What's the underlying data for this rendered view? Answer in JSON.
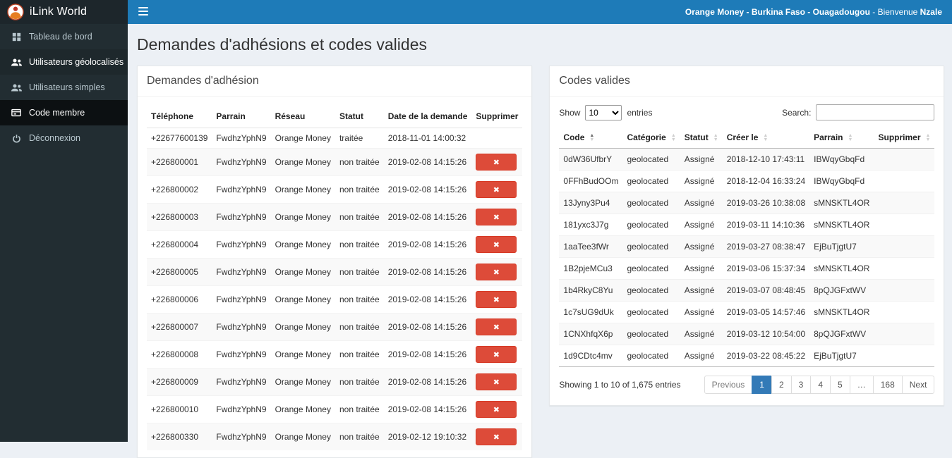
{
  "colors": {
    "topbar": "#1e7bb8",
    "sidebar": "#222d32",
    "sidebar_active": "#1e282c",
    "danger": "#dd4b39",
    "pagination_active": "#337ab7",
    "content_bg": "#ecf0f5"
  },
  "topbar": {
    "brand": "iLink World",
    "logo_icon": "ilink-logo-icon",
    "menu_icon": "hamburger-icon",
    "segments": [
      {
        "text": "Orange Money",
        "bold": true
      },
      {
        "text": " - ",
        "bold": true
      },
      {
        "text": "Burkina Faso",
        "bold": true
      },
      {
        "text": " - ",
        "bold": true
      },
      {
        "text": "Ouagadougou",
        "bold": true
      },
      {
        "text": " - Bienvenue ",
        "bold": false
      },
      {
        "text": "Nzale",
        "bold": true
      }
    ]
  },
  "sidebar": {
    "items": [
      {
        "label": "Tableau de bord",
        "icon": "dashboard-icon",
        "active": false,
        "highlight": false
      },
      {
        "label": "Utilisateurs géolocalisés",
        "icon": "users-icon",
        "active": true,
        "highlight": false
      },
      {
        "label": "Utilisateurs simples",
        "icon": "users-icon",
        "active": false,
        "highlight": false
      },
      {
        "label": "Code membre",
        "icon": "card-icon",
        "active": false,
        "highlight": true
      },
      {
        "label": "Déconnexion",
        "icon": "power-icon",
        "active": false,
        "highlight": false
      }
    ]
  },
  "page": {
    "title": "Demandes d'adhésions et codes valides"
  },
  "requests_panel": {
    "title": "Demandes d'adhésion",
    "columns": [
      "Téléphone",
      "Parrain",
      "Réseau",
      "Statut",
      "Date de la demande",
      "Supprimer"
    ],
    "delete_icon": "✖",
    "rows": [
      {
        "telephone": "+22677600139",
        "parrain": "FwdhzYphN9",
        "reseau": "Orange Money",
        "statut": "traitée",
        "date": "2018-11-01 14:00:32",
        "deletable": false
      },
      {
        "telephone": "+226800001",
        "parrain": "FwdhzYphN9",
        "reseau": "Orange Money",
        "statut": "non traitée",
        "date": "2019-02-08 14:15:26",
        "deletable": true
      },
      {
        "telephone": "+226800002",
        "parrain": "FwdhzYphN9",
        "reseau": "Orange Money",
        "statut": "non traitée",
        "date": "2019-02-08 14:15:26",
        "deletable": true
      },
      {
        "telephone": "+226800003",
        "parrain": "FwdhzYphN9",
        "reseau": "Orange Money",
        "statut": "non traitée",
        "date": "2019-02-08 14:15:26",
        "deletable": true
      },
      {
        "telephone": "+226800004",
        "parrain": "FwdhzYphN9",
        "reseau": "Orange Money",
        "statut": "non traitée",
        "date": "2019-02-08 14:15:26",
        "deletable": true
      },
      {
        "telephone": "+226800005",
        "parrain": "FwdhzYphN9",
        "reseau": "Orange Money",
        "statut": "non traitée",
        "date": "2019-02-08 14:15:26",
        "deletable": true
      },
      {
        "telephone": "+226800006",
        "parrain": "FwdhzYphN9",
        "reseau": "Orange Money",
        "statut": "non traitée",
        "date": "2019-02-08 14:15:26",
        "deletable": true
      },
      {
        "telephone": "+226800007",
        "parrain": "FwdhzYphN9",
        "reseau": "Orange Money",
        "statut": "non traitée",
        "date": "2019-02-08 14:15:26",
        "deletable": true
      },
      {
        "telephone": "+226800008",
        "parrain": "FwdhzYphN9",
        "reseau": "Orange Money",
        "statut": "non traitée",
        "date": "2019-02-08 14:15:26",
        "deletable": true
      },
      {
        "telephone": "+226800009",
        "parrain": "FwdhzYphN9",
        "reseau": "Orange Money",
        "statut": "non traitée",
        "date": "2019-02-08 14:15:26",
        "deletable": true
      },
      {
        "telephone": "+226800010",
        "parrain": "FwdhzYphN9",
        "reseau": "Orange Money",
        "statut": "non traitée",
        "date": "2019-02-08 14:15:26",
        "deletable": true
      },
      {
        "telephone": "+226800330",
        "parrain": "FwdhzYphN9",
        "reseau": "Orange Money",
        "statut": "non traitée",
        "date": "2019-02-12 19:10:32",
        "deletable": true
      }
    ]
  },
  "codes_panel": {
    "title": "Codes valides",
    "show_label": "Show",
    "entries_label": "entries",
    "page_length": "10",
    "search_label": "Search:",
    "search_value": "",
    "columns": [
      {
        "label": "Code",
        "sort": "asc"
      },
      {
        "label": "Catégorie",
        "sort": "none"
      },
      {
        "label": "Statut",
        "sort": "none"
      },
      {
        "label": "Créer le",
        "sort": "none"
      },
      {
        "label": "Parrain",
        "sort": "none"
      },
      {
        "label": "Supprimer",
        "sort": "none"
      }
    ],
    "rows": [
      {
        "code": "0dW36UfbrY",
        "categorie": "geolocated",
        "statut": "Assigné",
        "creer_le": "2018-12-10 17:43:11",
        "parrain": "IBWqyGbqFd",
        "supprimer": ""
      },
      {
        "code": "0FFhBudOOm",
        "categorie": "geolocated",
        "statut": "Assigné",
        "creer_le": "2018-12-04 16:33:24",
        "parrain": "IBWqyGbqFd",
        "supprimer": ""
      },
      {
        "code": "13Jyny3Pu4",
        "categorie": "geolocated",
        "statut": "Assigné",
        "creer_le": "2019-03-26 10:38:08",
        "parrain": "sMNSKTL4OR",
        "supprimer": ""
      },
      {
        "code": "181yxc3J7g",
        "categorie": "geolocated",
        "statut": "Assigné",
        "creer_le": "2019-03-11 14:10:36",
        "parrain": "sMNSKTL4OR",
        "supprimer": ""
      },
      {
        "code": "1aaTee3fWr",
        "categorie": "geolocated",
        "statut": "Assigné",
        "creer_le": "2019-03-27 08:38:47",
        "parrain": "EjBuTjgtU7",
        "supprimer": ""
      },
      {
        "code": "1B2pjeMCu3",
        "categorie": "geolocated",
        "statut": "Assigné",
        "creer_le": "2019-03-06 15:37:34",
        "parrain": "sMNSKTL4OR",
        "supprimer": ""
      },
      {
        "code": "1b4RkyC8Yu",
        "categorie": "geolocated",
        "statut": "Assigné",
        "creer_le": "2019-03-07 08:48:45",
        "parrain": "8pQJGFxtWV",
        "supprimer": ""
      },
      {
        "code": "1c7sUG9dUk",
        "categorie": "geolocated",
        "statut": "Assigné",
        "creer_le": "2019-03-05 14:57:46",
        "parrain": "sMNSKTL4OR",
        "supprimer": ""
      },
      {
        "code": "1CNXhfqX6p",
        "categorie": "geolocated",
        "statut": "Assigné",
        "creer_le": "2019-03-12 10:54:00",
        "parrain": "8pQJGFxtWV",
        "supprimer": ""
      },
      {
        "code": "1d9CDtc4mv",
        "categorie": "geolocated",
        "statut": "Assigné",
        "creer_le": "2019-03-22 08:45:22",
        "parrain": "EjBuTjgtU7",
        "supprimer": ""
      }
    ],
    "footer": {
      "info": "Showing 1 to 10 of 1,675 entries",
      "pagination": [
        "Previous",
        "1",
        "2",
        "3",
        "4",
        "5",
        "…",
        "168",
        "Next"
      ],
      "active_page": "1"
    }
  }
}
